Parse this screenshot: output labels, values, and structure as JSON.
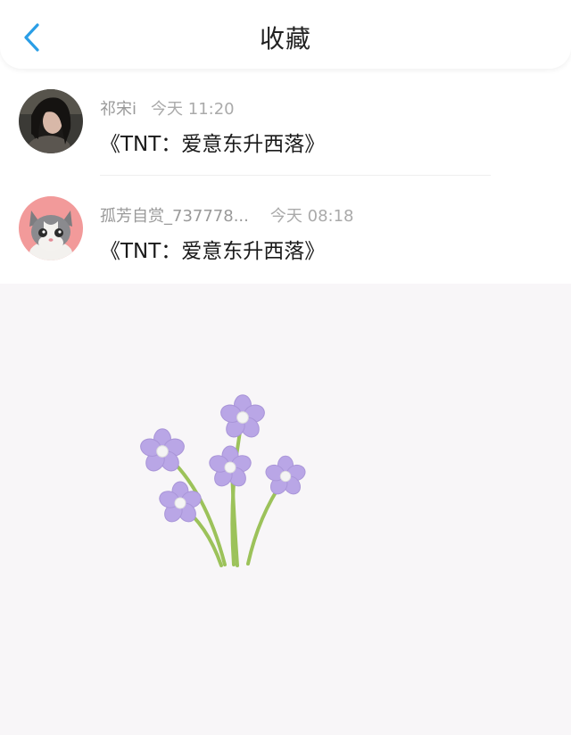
{
  "header": {
    "title": "收藏",
    "back_icon": "chevron-left-icon",
    "accent": "#2a9ee6"
  },
  "items": [
    {
      "author": "祁宋i",
      "time": "今天 11:20",
      "content": "《TNT：爱意东升西落》",
      "avatar": "photo-avatar"
    },
    {
      "author": "孤芳自赏_737778...",
      "time": "今天 08:18",
      "content": "《TNT：爱意东升西落》",
      "avatar": "cat-avatar"
    }
  ],
  "decoration": {
    "name": "purple-flowers-illustration",
    "petal_color": "#b9a6e6",
    "stem_color": "#9cc25a"
  }
}
